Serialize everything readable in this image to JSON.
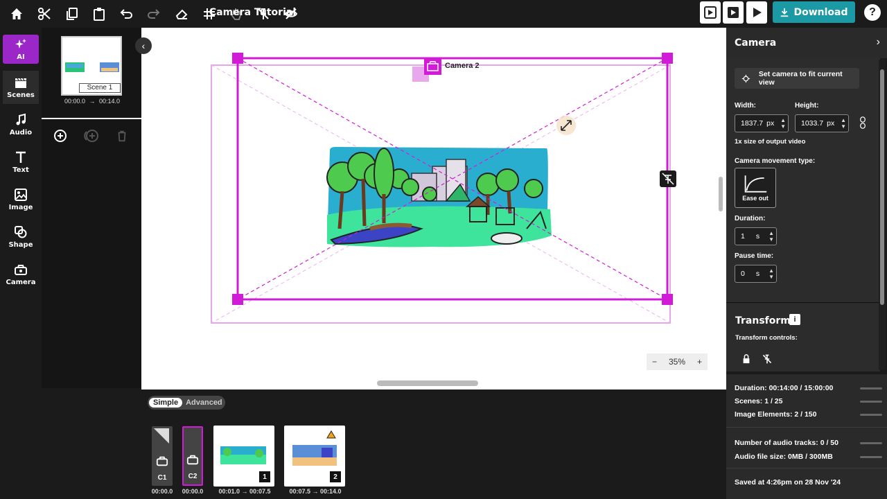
{
  "toolbar": {
    "icons": [
      "home-icon",
      "scissors-icon",
      "copy-icon",
      "paste-icon",
      "undo-icon",
      "redo-icon",
      "eraser-icon",
      "grid-icon",
      "hand-icon",
      "unpin-icon",
      "hide-icon"
    ],
    "title": "Camera Tutorial",
    "download_label": "Download",
    "help_label": "?"
  },
  "nav": {
    "items": [
      {
        "label": "AI"
      },
      {
        "label": "Scenes"
      },
      {
        "label": "Audio"
      },
      {
        "label": "Text"
      },
      {
        "label": "Image"
      },
      {
        "label": "Shape"
      },
      {
        "label": "Camera"
      }
    ]
  },
  "scenes": {
    "scene_label": "Scene 1",
    "start": "00:00.0",
    "end": "00:14.0"
  },
  "canvas": {
    "camera_label": "Camera 2",
    "zoom": "35%",
    "zoom_minus": "−",
    "zoom_plus": "+"
  },
  "bottom": {
    "mode_simple": "Simple",
    "mode_advanced": "Advanced",
    "tiles": [
      {
        "label": "C1",
        "time": "00:00.0"
      },
      {
        "label": "C2",
        "time": "00:00.0"
      },
      {
        "num": "1",
        "time": "00:01.0 → 00:07.5"
      },
      {
        "num": "2",
        "time": "00:07.5 → 00:14.0"
      }
    ]
  },
  "panel": {
    "title": "Camera",
    "fit_button": "Set camera to fit current view",
    "width_label": "Width:",
    "width_value": "1837.7",
    "height_label": "Height:",
    "height_value": "1033.7",
    "unit_px": "px",
    "size_note": "1x size of output video",
    "movement_label": "Camera movement type:",
    "movement_value": "Ease out",
    "duration_label": "Duration:",
    "duration_value": "1",
    "pause_label": "Pause time:",
    "pause_value": "0",
    "unit_s": "s",
    "transform_title": "Transform",
    "transform_controls": "Transform controls:"
  },
  "stats": {
    "duration": "Duration: 00:14:00 / 15:00:00",
    "scenes": "Scenes: 1 / 25",
    "image_elements": "Image Elements: 2 / 150",
    "audio_tracks": "Number of audio tracks: 0 / 50",
    "audio_size": "Audio file size: 0MB / 300MB",
    "saved": "Saved at 4:26pm on 28 Nov '24"
  },
  "colors": {
    "accent": "#d21bd6",
    "download": "#1b9aa5",
    "ai": "#9b27c8"
  }
}
